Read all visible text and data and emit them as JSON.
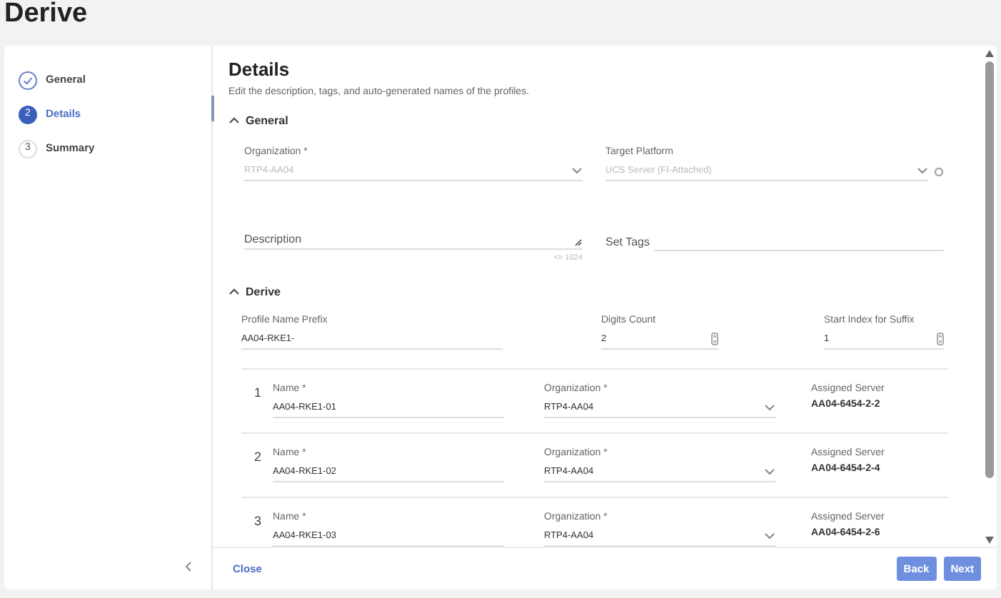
{
  "title": "Derive",
  "steps": [
    {
      "kind": "done",
      "label": "General",
      "selected": false
    },
    {
      "kind": "numbered",
      "number": "2",
      "label": "Details",
      "selected": true
    },
    {
      "kind": "numbered",
      "number": "3",
      "label": "Summary",
      "selected": false
    }
  ],
  "details": {
    "heading": "Details",
    "description": "Edit the description, tags, and auto-generated names of the profiles."
  },
  "general": {
    "title": "General",
    "expanded": true,
    "organization": {
      "label": "Organization *",
      "value": "RTP4-AA04",
      "disabled": true
    },
    "target_platform": {
      "label": "Target Platform",
      "value": "UCS Server (FI-Attached)",
      "disabled": true
    },
    "description": {
      "label": "Description",
      "hint": "<= 1024"
    },
    "tags": {
      "label": "Set Tags"
    }
  },
  "derive": {
    "title": "Derive",
    "expanded": true,
    "prefix": {
      "label": "Profile Name Prefix",
      "value": "AA04-RKE1-"
    },
    "digits_count": {
      "label": "Digits Count",
      "value": "2"
    },
    "start_index": {
      "label": "Start Index for Suffix",
      "value": "1"
    },
    "profiles": [
      {
        "index": "1",
        "name_label": "Name *",
        "name": "AA04-RKE1-01",
        "org_label": "Organization *",
        "organization": "RTP4-AA04",
        "server_label": "Assigned Server",
        "server": "AA04-6454-2-2"
      },
      {
        "index": "2",
        "name_label": "Name *",
        "name": "AA04-RKE1-02",
        "org_label": "Organization *",
        "organization": "RTP4-AA04",
        "server_label": "Assigned Server",
        "server": "AA04-6454-2-4"
      },
      {
        "index": "3",
        "name_label": "Name *",
        "name": "AA04-RKE1-03",
        "org_label": "Organization *",
        "organization": "RTP4-AA04",
        "server_label": "Assigned Server",
        "server": "AA04-6454-2-6"
      }
    ]
  },
  "footer": {
    "close": "Close",
    "back": "Back",
    "next": "Next"
  }
}
